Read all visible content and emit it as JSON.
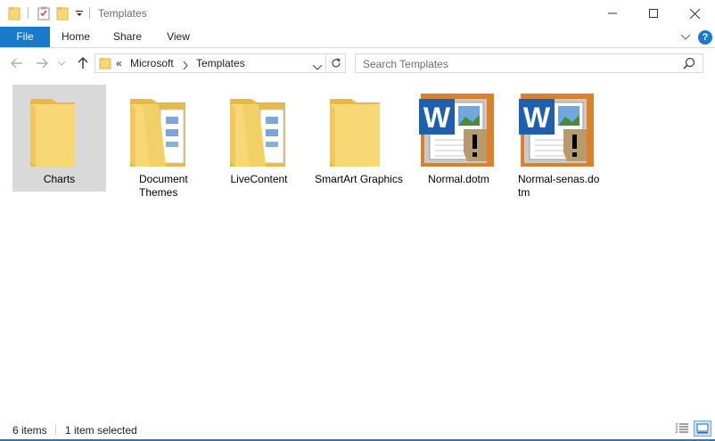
{
  "window": {
    "title": "Templates"
  },
  "ribbon": {
    "tabs": [
      "File",
      "Home",
      "Share",
      "View"
    ]
  },
  "address": {
    "overflow": "«",
    "crumbs": [
      "Microsoft",
      "Templates"
    ]
  },
  "search": {
    "placeholder": "Search Templates"
  },
  "items": [
    {
      "name": "Charts",
      "type": "folder",
      "selected": true
    },
    {
      "name": "Document Themes",
      "type": "folder-with-docs"
    },
    {
      "name": "LiveContent",
      "type": "folder-with-docs"
    },
    {
      "name": "SmartArt Graphics",
      "type": "folder"
    },
    {
      "name": "Normal.dotm",
      "type": "word-macro-template"
    },
    {
      "name": "Normal-senas.dotm",
      "type": "word-macro-template"
    }
  ],
  "status": {
    "item_count": "6 items",
    "selection": "1 item selected"
  },
  "colors": {
    "accent": "#1979ca",
    "folder": "#f8d775",
    "selection": "#d9d9d9"
  }
}
